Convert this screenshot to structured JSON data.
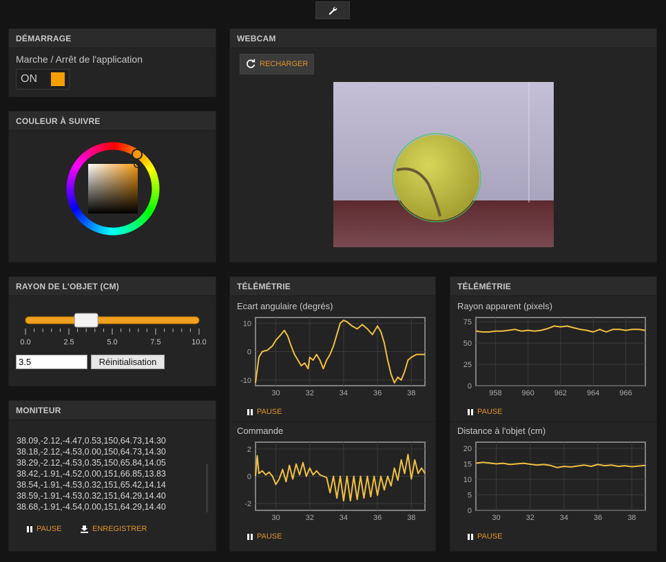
{
  "toolbar": {
    "settings_icon": "wrench-icon"
  },
  "demarrage": {
    "title": "DÉMARRAGE",
    "label": "Marche / Arrêt de l'application",
    "toggle_text": "ON",
    "toggle_on": true,
    "accent": "#f5a000"
  },
  "couleur": {
    "title": "COULEUR À SUIVRE",
    "selected_color": "#f59a10"
  },
  "webcam": {
    "title": "WEBCAM",
    "reload_label": "RECHARGER",
    "reload_icon": "refresh-icon"
  },
  "rayon": {
    "title": "RAYON DE L'OBJET (CM)",
    "value": "3.5",
    "slider_value": 3.5,
    "slider_min": 0,
    "slider_max": 10,
    "ticks": [
      "0.0",
      "2.5",
      "5.0",
      "7.5",
      "10.0"
    ],
    "reset_label": "Réinitialisation"
  },
  "moniteur": {
    "title": "MONITEUR",
    "lines": [
      "38.09,-2.12,-4.47,0.53,150,64.73,14.30",
      "38.18,-2.12,-4.53,0.00,150,64.73,14.30",
      "38.29,-2.12,-4.53,0.35,150,65.84,14.05",
      "38.42,-1.91,-4.52,0.00,151,66.85,13.83",
      "38.54,-1.91,-4.53,0.32,151,65.42,14.14",
      "38.59,-1.91,-4.53,0.32,151,64.29,14.40",
      "38.68,-1.91,-4.54,0.00,151,64.29,14.40"
    ],
    "pause_label": "PAUSE",
    "save_label": "ENREGISTRER"
  },
  "telemetrie_left": {
    "title": "TÉLÉMÉTRIE",
    "pause_label": "PAUSE"
  },
  "telemetrie_right": {
    "title": "TÉLÉMÉTRIE",
    "pause_label": "PAUSE"
  },
  "chart_data": [
    {
      "type": "line",
      "title": "Ecart angulaire (degrés)",
      "xlim": [
        28.8,
        38.8
      ],
      "ylim": [
        -12,
        12
      ],
      "xticks": [
        "30",
        "32",
        "34",
        "36",
        "38"
      ],
      "yticks": [
        "10",
        "0",
        "-10"
      ],
      "series": [
        {
          "color": "#f0c040",
          "x": [
            28.8,
            29.0,
            29.2,
            29.5,
            29.8,
            30.0,
            30.3,
            30.5,
            30.7,
            30.9,
            31.1,
            31.3,
            31.5,
            31.7,
            31.9,
            32.0,
            32.2,
            32.4,
            32.6,
            32.8,
            33.0,
            33.2,
            33.4,
            33.6,
            33.8,
            34.0,
            34.2,
            34.5,
            34.8,
            35.1,
            35.4,
            35.7,
            36.0,
            36.2,
            36.4,
            36.6,
            36.8,
            37.0,
            37.2,
            37.4,
            37.6,
            37.8,
            38.0,
            38.3,
            38.6,
            38.8
          ],
          "y": [
            -11,
            -2,
            0,
            0.5,
            2,
            4,
            6,
            7.5,
            5.5,
            2,
            -1,
            -3,
            -5,
            -4,
            -6,
            -2,
            -3,
            -1,
            -3,
            -6,
            -3,
            -1,
            2,
            6,
            10,
            11,
            10.5,
            9,
            8,
            9.5,
            8,
            6,
            9,
            7,
            3,
            -3,
            -8,
            -11,
            -9,
            -10,
            -7,
            -3,
            -2,
            -1,
            -1,
            -1
          ]
        }
      ]
    },
    {
      "type": "line",
      "title": "Commande",
      "xlim": [
        28.8,
        38.8
      ],
      "ylim": [
        -2.5,
        2.5
      ],
      "xticks": [
        "30",
        "32",
        "34",
        "36",
        "38"
      ],
      "yticks": [
        "2",
        "0",
        "-2"
      ],
      "series": [
        {
          "color": "#f0c040",
          "x": [
            28.8,
            28.9,
            29.0,
            29.2,
            29.4,
            29.6,
            29.8,
            30.0,
            30.2,
            30.4,
            30.6,
            30.8,
            31.0,
            31.2,
            31.4,
            31.6,
            31.8,
            32.0,
            32.2,
            32.4,
            32.6,
            32.8,
            33.0,
            33.2,
            33.4,
            33.6,
            33.8,
            34.0,
            34.2,
            34.4,
            34.6,
            34.8,
            35.0,
            35.2,
            35.4,
            35.6,
            35.8,
            36.0,
            36.2,
            36.4,
            36.6,
            36.8,
            37.0,
            37.2,
            37.4,
            37.6,
            37.8,
            38.0,
            38.2,
            38.4,
            38.6,
            38.8
          ],
          "y": [
            0,
            1.5,
            0.2,
            0.4,
            0.1,
            0.3,
            0,
            -0.6,
            -0.2,
            0.5,
            -0.4,
            0.8,
            -0.2,
            0.9,
            0.1,
            1.0,
            0,
            0.6,
            0.1,
            0.4,
            0.1,
            0,
            -0.1,
            -1.2,
            0,
            -1.6,
            0,
            -1.8,
            0,
            -1.8,
            0,
            -1.7,
            0,
            -1.6,
            0,
            -1.5,
            0,
            -1.4,
            0,
            -1.0,
            0,
            -0.7,
            0.6,
            -0.3,
            1.2,
            0.2,
            1.6,
            -0.2,
            1.2,
            0.2,
            0.6,
            0.2
          ]
        }
      ]
    },
    {
      "type": "line",
      "title": "Rayon apparent (pixels)",
      "xlim": [
        956.8,
        967.2
      ],
      "ylim": [
        0,
        80
      ],
      "xticks": [
        "958",
        "960",
        "962",
        "964",
        "966"
      ],
      "yticks": [
        "75",
        "50",
        "25",
        "0"
      ],
      "series": [
        {
          "color": "#f0c040",
          "x": [
            956.8,
            957.2,
            957.6,
            958.0,
            958.4,
            958.8,
            959.2,
            959.6,
            960.0,
            960.4,
            960.8,
            961.2,
            961.6,
            962.0,
            962.4,
            962.8,
            963.2,
            963.6,
            964.0,
            964.4,
            964.8,
            965.2,
            965.6,
            966.0,
            966.4,
            966.8,
            967.2
          ],
          "y": [
            64,
            63,
            63,
            64,
            64,
            65,
            66,
            64,
            65,
            64,
            65,
            67,
            70,
            69,
            70,
            68,
            66,
            65,
            63,
            66,
            63,
            66,
            66,
            65,
            66,
            66,
            65
          ]
        }
      ]
    },
    {
      "type": "line",
      "title": "Distance à l'objet (cm)",
      "xlim": [
        28.8,
        38.8
      ],
      "ylim": [
        0,
        22
      ],
      "xticks": [
        "30",
        "32",
        "34",
        "36",
        "38"
      ],
      "yticks": [
        "20",
        "15",
        "10",
        "5",
        "0"
      ],
      "series": [
        {
          "color": "#f0c040",
          "x": [
            28.8,
            29.2,
            29.6,
            30.0,
            30.4,
            30.8,
            31.2,
            31.6,
            32.0,
            32.4,
            32.8,
            33.2,
            33.6,
            34.0,
            34.4,
            34.8,
            35.2,
            35.6,
            36.0,
            36.4,
            36.8,
            37.2,
            37.6,
            38.0,
            38.4,
            38.8
          ],
          "y": [
            15.2,
            15.5,
            15.3,
            15.0,
            15.2,
            14.8,
            15.0,
            15.2,
            14.9,
            14.6,
            14.8,
            14.5,
            13.8,
            14.2,
            14.0,
            14.3,
            14.6,
            14.2,
            14.8,
            14.4,
            14.6,
            14.2,
            14.4,
            14.1,
            14.3,
            14.5
          ]
        }
      ]
    }
  ]
}
